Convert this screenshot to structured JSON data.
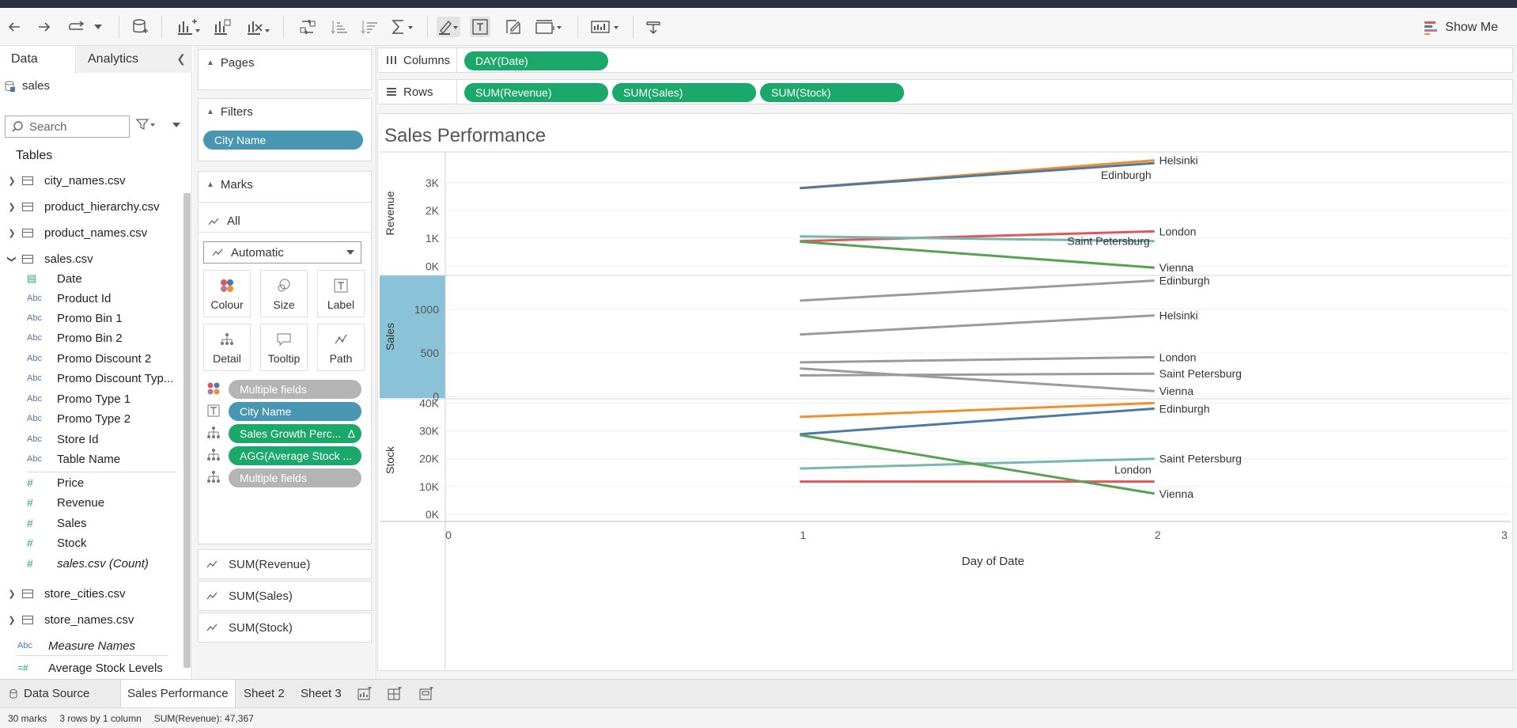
{
  "toolbar": {
    "show_me_label": "Show Me",
    "icons": [
      "back-icon",
      "forward-icon",
      "redo-icon",
      "new-datasource-icon",
      "new-worksheet-icon",
      "duplicate-icon",
      "clear-icon",
      "swap-icon",
      "sort-asc-icon",
      "sort-desc-icon",
      "totals-icon",
      "highlight-icon",
      "labels-icon",
      "annotate-icon",
      "fit-icon",
      "fit-dropdown",
      "presentation-icon",
      "share-icon"
    ]
  },
  "data_pane": {
    "tab_data": "Data",
    "tab_analytics": "Analytics",
    "datasource": "sales",
    "search_placeholder": "Search",
    "tables_heading": "Tables",
    "tables": [
      {
        "name": "city_names.csv",
        "expanded": false
      },
      {
        "name": "product_hierarchy.csv",
        "expanded": false
      },
      {
        "name": "product_names.csv",
        "expanded": false
      },
      {
        "name": "sales.csv",
        "expanded": true
      },
      {
        "name": "store_cities.csv",
        "expanded": false
      },
      {
        "name": "store_names.csv",
        "expanded": false
      }
    ],
    "dimension_fields": [
      {
        "name": "Date",
        "type": "date"
      },
      {
        "name": "Product Id",
        "type": "Abc"
      },
      {
        "name": "Promo Bin 1",
        "type": "Abc"
      },
      {
        "name": "Promo Bin 2",
        "type": "Abc"
      },
      {
        "name": "Promo Discount 2",
        "type": "Abc"
      },
      {
        "name": "Promo Discount Typ...",
        "type": "Abc"
      },
      {
        "name": "Promo Type 1",
        "type": "Abc"
      },
      {
        "name": "Promo Type 2",
        "type": "Abc"
      },
      {
        "name": "Store Id",
        "type": "Abc"
      },
      {
        "name": "Table Name",
        "type": "Abc"
      }
    ],
    "measure_fields": [
      {
        "name": "Price",
        "type": "#"
      },
      {
        "name": "Revenue",
        "type": "#"
      },
      {
        "name": "Sales",
        "type": "#"
      },
      {
        "name": "Stock",
        "type": "#"
      },
      {
        "name": "sales.csv (Count)",
        "type": "#"
      }
    ],
    "extra_fields": [
      {
        "name": "Measure Names",
        "type": "Abc"
      },
      {
        "name": "Average Stock Levels",
        "type": "=#"
      }
    ]
  },
  "shelves": {
    "pages_title": "Pages",
    "filters_title": "Filters",
    "filter_pill": "City Name",
    "marks_title": "Marks",
    "marks_all": "All",
    "mark_type": "Automatic",
    "mark_buttons": [
      "Colour",
      "Size",
      "Label",
      "Detail",
      "Tooltip",
      "Path"
    ],
    "mark_fields": [
      {
        "label": "Multiple fields",
        "color": "grey",
        "icon": "colour-icon"
      },
      {
        "label": "City Name",
        "color": "blue",
        "icon": "label-icon"
      },
      {
        "label": "Sales Growth Perc...",
        "color": "green",
        "icon": "detail-icon",
        "delta": "Δ"
      },
      {
        "label": "AGG(Average Stock ...",
        "color": "green",
        "icon": "detail-icon"
      },
      {
        "label": "Multiple fields",
        "color": "grey",
        "icon": "detail-icon"
      }
    ],
    "measure_cards": [
      "SUM(Revenue)",
      "SUM(Sales)",
      "SUM(Stock)"
    ]
  },
  "columns_shelf": {
    "label": "Columns",
    "pills": [
      "DAY(Date)"
    ]
  },
  "rows_shelf": {
    "label": "Rows",
    "pills": [
      "SUM(Revenue)",
      "SUM(Sales)",
      "SUM(Stock)"
    ]
  },
  "sheet_title": "Sales Performance",
  "chart_data": {
    "type": "line",
    "x_label": "Day of Date",
    "x_ticks": [
      "0",
      "1",
      "2",
      "3"
    ],
    "xlim": [
      0,
      3
    ],
    "colors": {
      "Helsinki": "#f28e2b",
      "Edinburgh": "#4e79a7",
      "London": "#e15759",
      "Saint Petersburg": "#76b7b2",
      "Vienna": "#59a14f",
      "grey": "#9b9b9b"
    },
    "panes": [
      {
        "measure": "Revenue",
        "ylim": [
          -300,
          4100
        ],
        "y_ticks": [
          {
            "v": 0,
            "t": "0K"
          },
          {
            "v": 1000,
            "t": "1K"
          },
          {
            "v": 2000,
            "t": "2K"
          },
          {
            "v": 3000,
            "t": "3K"
          }
        ],
        "highlighted": false,
        "series": [
          {
            "name": "Helsinki",
            "x": [
              1,
              2
            ],
            "y": [
              2800,
              3800
            ],
            "color": "#f28e2b",
            "label": "Helsinki",
            "label_side": "right"
          },
          {
            "name": "Edinburgh",
            "x": [
              1,
              2
            ],
            "y": [
              2800,
              3700
            ],
            "color": "#4e79a7",
            "label": "Edinburgh",
            "label_side": "left-below"
          },
          {
            "name": "London",
            "x": [
              1,
              2
            ],
            "y": [
              900,
              1250
            ],
            "color": "#e15759",
            "label": "London",
            "label_side": "right"
          },
          {
            "name": "Saint Petersburg",
            "x": [
              1,
              2
            ],
            "y": [
              1070,
              900
            ],
            "color": "#76b7b2",
            "label": "Saint Petersburg",
            "label_side": "left"
          },
          {
            "name": "Vienna",
            "x": [
              1,
              2
            ],
            "y": [
              880,
              -50
            ],
            "color": "#59a14f",
            "label": "Vienna",
            "label_side": "right"
          }
        ]
      },
      {
        "measure": "Sales",
        "ylim": [
          -20,
          1390
        ],
        "y_ticks": [
          {
            "v": 0,
            "t": "0"
          },
          {
            "v": 500,
            "t": "500"
          },
          {
            "v": 1000,
            "t": "1000"
          }
        ],
        "highlighted": true,
        "series": [
          {
            "name": "Edinburgh",
            "x": [
              1,
              2
            ],
            "y": [
              1100,
              1330
            ],
            "color": "#9b9b9b",
            "label": "Edinburgh",
            "label_side": "right"
          },
          {
            "name": "Helsinki",
            "x": [
              1,
              2
            ],
            "y": [
              710,
              930
            ],
            "color": "#9b9b9b",
            "label": "Helsinki",
            "label_side": "right"
          },
          {
            "name": "London",
            "x": [
              1,
              2
            ],
            "y": [
              390,
              450
            ],
            "color": "#9b9b9b",
            "label": "London",
            "label_side": "right"
          },
          {
            "name": "Saint Petersburg",
            "x": [
              1,
              2
            ],
            "y": [
              240,
              260
            ],
            "color": "#9b9b9b",
            "label": "Saint Petersburg",
            "label_side": "right"
          },
          {
            "name": "Vienna",
            "x": [
              1,
              2
            ],
            "y": [
              320,
              60
            ],
            "color": "#9b9b9b",
            "label": "Vienna",
            "label_side": "right"
          }
        ]
      },
      {
        "measure": "Stock",
        "ylim": [
          -2500,
          41500
        ],
        "y_ticks": [
          {
            "v": 0,
            "t": "0K"
          },
          {
            "v": 10000,
            "t": "10K"
          },
          {
            "v": 20000,
            "t": "20K"
          },
          {
            "v": 30000,
            "t": "30K"
          },
          {
            "v": 40000,
            "t": "40K"
          }
        ],
        "highlighted": false,
        "series": [
          {
            "name": "Helsinki",
            "x": [
              1,
              2
            ],
            "y": [
              35000,
              40000
            ],
            "color": "#f28e2b",
            "label": "",
            "label_side": "none"
          },
          {
            "name": "Edinburgh",
            "x": [
              1,
              2
            ],
            "y": [
              28800,
              38000
            ],
            "color": "#4e79a7",
            "label": "Edinburgh",
            "label_side": "right"
          },
          {
            "name": "Saint Petersburg",
            "x": [
              1,
              2
            ],
            "y": [
              16500,
              20000
            ],
            "color": "#76b7b2",
            "label": "Saint Petersburg",
            "label_side": "right"
          },
          {
            "name": "London",
            "x": [
              1,
              2
            ],
            "y": [
              11800,
              11800
            ],
            "color": "#e15759",
            "label": "London",
            "label_side": "left-above"
          },
          {
            "name": "Vienna",
            "x": [
              1,
              2
            ],
            "y": [
              28500,
              7500
            ],
            "color": "#59a14f",
            "label": "Vienna",
            "label_side": "right"
          }
        ]
      }
    ]
  },
  "sheet_tabs": {
    "data_source": "Data Source",
    "tabs": [
      "Sales Performance",
      "Sheet 2",
      "Sheet 3"
    ],
    "active": "Sales Performance"
  },
  "status": {
    "marks": "30 marks",
    "layout": "3 rows by 1 column",
    "sum": "SUM(Revenue): 47,367"
  }
}
